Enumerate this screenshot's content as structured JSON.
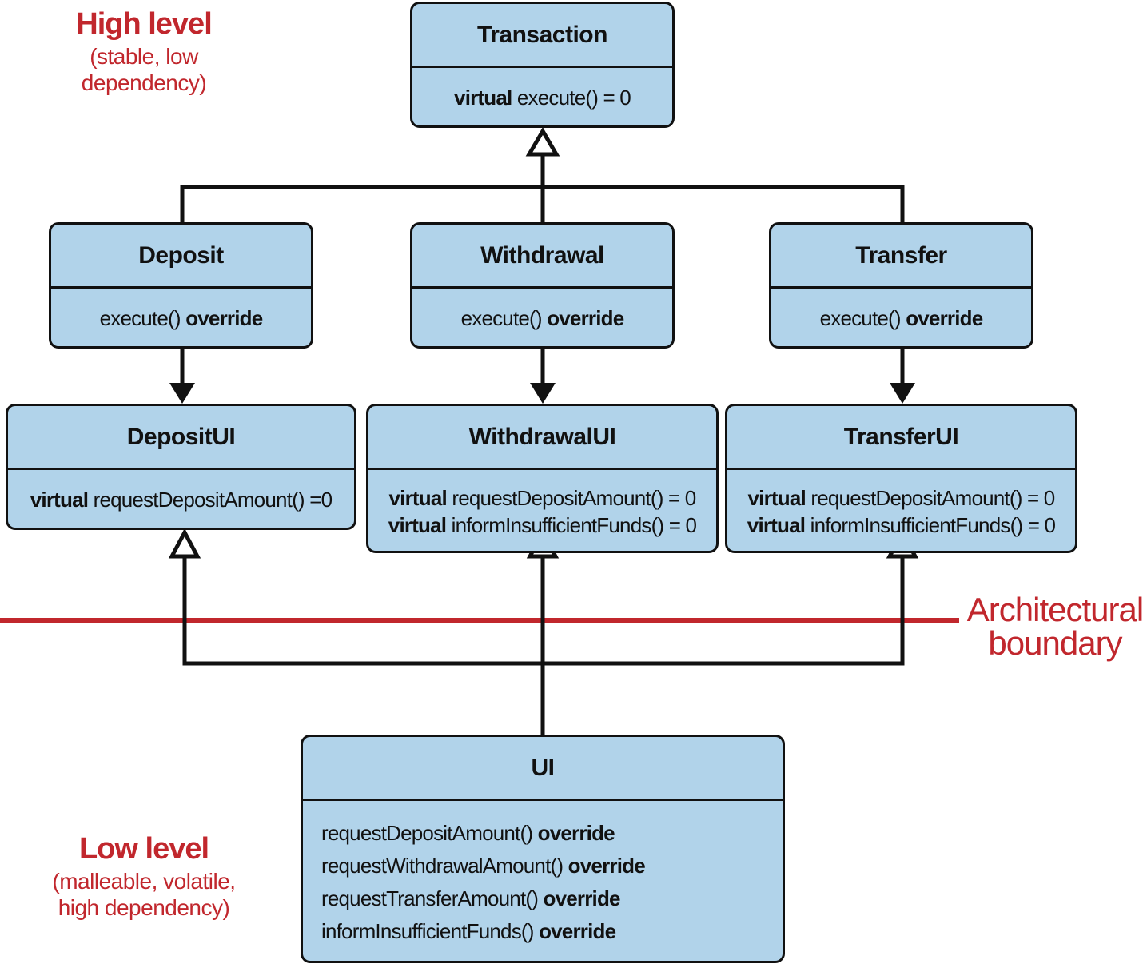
{
  "colors": {
    "box_fill": "#b1d3ea",
    "line": "#111111",
    "accent_red": "#c1272d"
  },
  "labels": {
    "high_level": {
      "title": "High level",
      "subtitle": "(stable, low dependency)"
    },
    "low_level": {
      "title": "Low level",
      "subtitle": "(malleable, volatile, high dependency)"
    },
    "boundary": {
      "line1": "Architectural",
      "line2": "boundary"
    }
  },
  "classes": {
    "transaction": {
      "name": "Transaction",
      "members": [
        {
          "kw": "virtual",
          "sig": " execute() = 0"
        }
      ]
    },
    "deposit": {
      "name": "Deposit",
      "members": [
        {
          "sig": "execute() ",
          "kw2": "override"
        }
      ]
    },
    "withdrawal": {
      "name": "Withdrawal",
      "members": [
        {
          "sig": "execute() ",
          "kw2": "override"
        }
      ]
    },
    "transfer": {
      "name": "Transfer",
      "members": [
        {
          "sig": "execute() ",
          "kw2": "override"
        }
      ]
    },
    "deposit_ui": {
      "name": "DepositUI",
      "members": [
        {
          "kw": "virtual",
          "sig": " requestDepositAmount() =0"
        }
      ]
    },
    "withdrawal_ui": {
      "name": "WithdrawalUI",
      "members": [
        {
          "kw": "virtual",
          "sig": " requestDepositAmount() = 0"
        },
        {
          "kw": "virtual",
          "sig": " informInsufficientFunds() = 0"
        }
      ]
    },
    "transfer_ui": {
      "name": "TransferUI",
      "members": [
        {
          "kw": "virtual",
          "sig": " requestDepositAmount() = 0"
        },
        {
          "kw": "virtual",
          "sig": " informInsufficientFunds() = 0"
        }
      ]
    },
    "ui": {
      "name": "UI",
      "members": [
        {
          "sig": "requestDepositAmount() ",
          "kw2": "override"
        },
        {
          "sig": "requestWithdrawalAmount() ",
          "kw2": "override"
        },
        {
          "sig": "requestTransferAmount() ",
          "kw2": "override"
        },
        {
          "sig": "informInsufficientFunds() ",
          "kw2": "override"
        }
      ]
    }
  }
}
